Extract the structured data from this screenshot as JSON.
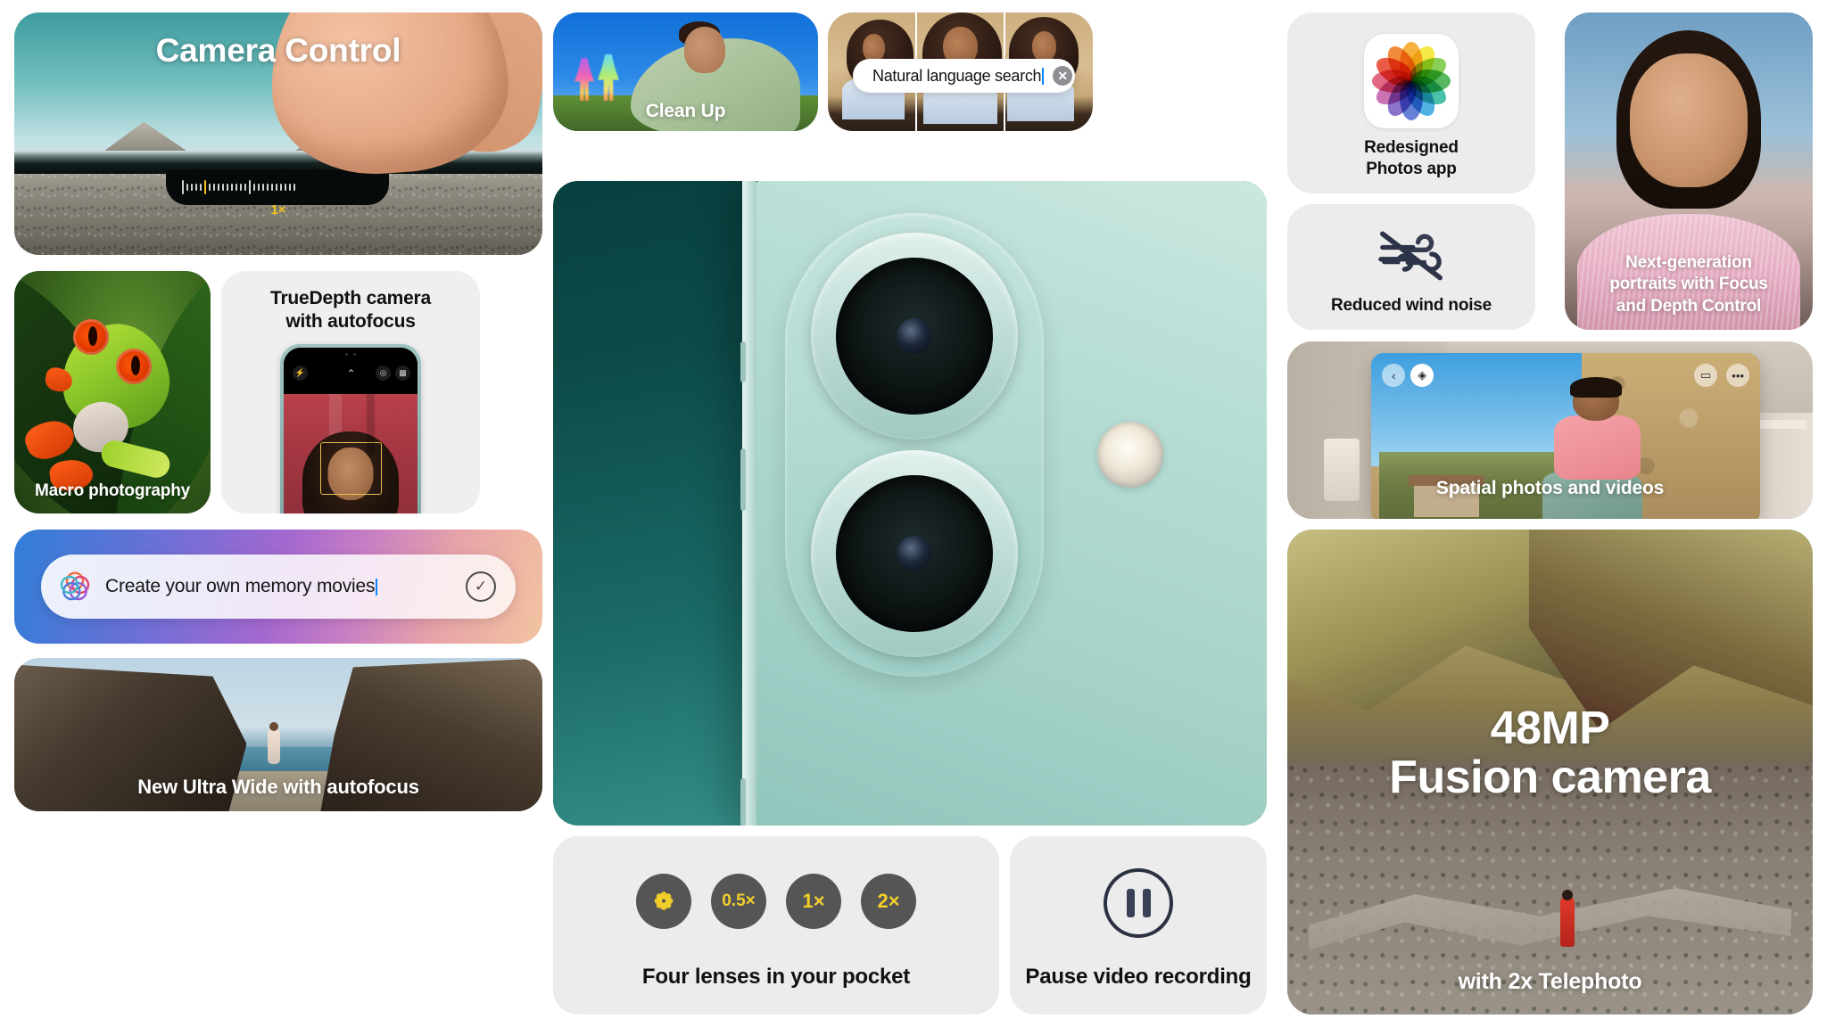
{
  "tiles": {
    "camera_control": {
      "title": "Camera Control",
      "zoom_value": "1×"
    },
    "clean_up": {
      "caption": "Clean Up"
    },
    "natural_language_search": {
      "query": "Natural language search",
      "search_icon": "search-icon",
      "clear_icon": "clear-circle-icon",
      "clear_glyph": "✕"
    },
    "photos_app": {
      "label_line1": "Redesigned",
      "label_line2": "Photos app",
      "icon": "photos-app-icon"
    },
    "wind_noise": {
      "label": "Reduced wind noise",
      "icon": "wind-slash-icon"
    },
    "portraits": {
      "line1": "Next-generation",
      "line2": "portraits with Focus",
      "line3": "and Depth Control"
    },
    "spatial": {
      "caption": "Spatial photos and videos",
      "controls": {
        "back": "‹",
        "spatial": "◈",
        "video": "▭",
        "more": "•••"
      }
    },
    "fusion": {
      "title_line1": "48MP",
      "title_line2": "Fusion camera",
      "subtitle": "with 2x Telephoto"
    },
    "macro": {
      "caption": "Macro photography"
    },
    "truedepth": {
      "title_line1": "TrueDepth camera",
      "title_line2": "with autofocus",
      "controls": [
        "flash-icon",
        "chevron-up-icon",
        "live-photo-icon",
        "filters-icon"
      ],
      "control_glyphs": [
        "⚡",
        "⌃",
        "◎",
        "▩"
      ]
    },
    "memory_movies": {
      "prompt": "Create your own memory movies",
      "ai_icon": "apple-intelligence-icon",
      "submit_icon": "check-circle-icon",
      "submit_glyph": "✓"
    },
    "ultra_wide": {
      "caption": "New Ultra Wide with autofocus"
    },
    "four_lenses": {
      "label": "Four lenses in your pocket",
      "buttons": [
        {
          "name": "macro-lens-button",
          "value": "❁",
          "is_icon": true
        },
        {
          "name": "ultra-wide-lens-button",
          "value": "0.5×",
          "is_icon": false
        },
        {
          "name": "wide-lens-button",
          "value": "1×",
          "is_icon": false
        },
        {
          "name": "telephoto-lens-button",
          "value": "2×",
          "is_icon": false
        }
      ]
    },
    "pause_video": {
      "label": "Pause video recording",
      "icon": "pause-circle-icon"
    }
  },
  "colors": {
    "tile_grey": "#ececec",
    "accent_yellow": "#f3cf2a",
    "caret_blue": "#0a84ff",
    "lens_button": "#555555",
    "teal_dark": "#07403f"
  }
}
